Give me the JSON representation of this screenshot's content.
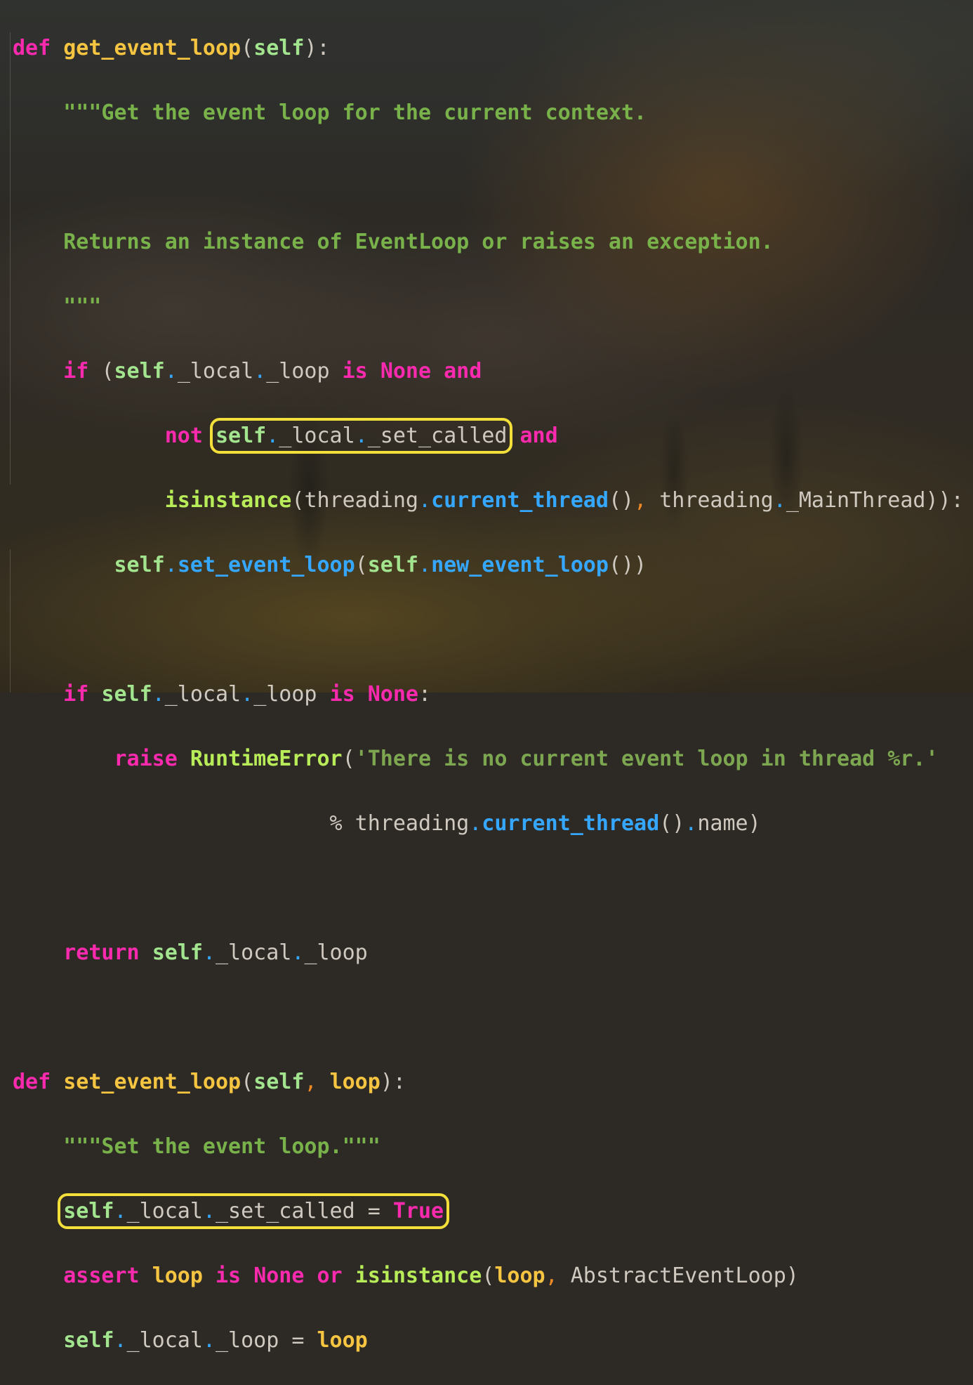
{
  "code": {
    "l1": {
      "def": "def",
      "name": "get_event_loop",
      "open": "(",
      "self": "self",
      "close": "):"
    },
    "l2": {
      "doc": "\"\"\"Get the event loop for the current context."
    },
    "l4": {
      "doc": "Returns an instance of EventLoop or raises an exception."
    },
    "l5": {
      "doc": "\"\"\""
    },
    "l6": {
      "if": "if",
      "open": "(",
      "self": "self",
      "a": "_local",
      "b": "_loop",
      "is": "is",
      "none": "None",
      "and": "and"
    },
    "l7": {
      "not": "not",
      "self": "self",
      "a": "_local",
      "b": "_set_called",
      "and": "and"
    },
    "l8": {
      "isinstance": "isinstance",
      "open": "(",
      "threading": "threading",
      "current_thread": "current_thread",
      "parens": "()",
      "comma": ",",
      "threading2": "threading",
      "main": "_MainThread",
      "close": ")):"
    },
    "l9": {
      "self": "self",
      "set": "set_event_loop",
      "open": "(",
      "self2": "self",
      "new": "new_event_loop",
      "close": "())"
    },
    "l11": {
      "if": "if",
      "self": "self",
      "a": "_local",
      "b": "_loop",
      "is": "is",
      "none": "None",
      "colon": ":"
    },
    "l12": {
      "raise": "raise",
      "err": "RuntimeError",
      "open": "(",
      "str": "'There is no current event loop in thread %r.'"
    },
    "l13": {
      "pct": "%",
      "threading": "threading",
      "current_thread": "current_thread",
      "parens": "()",
      "name": "name",
      "close": ")"
    },
    "l15": {
      "return": "return",
      "self": "self",
      "a": "_local",
      "b": "_loop"
    },
    "l17": {
      "def": "def",
      "name": "set_event_loop",
      "open": "(",
      "self": "self",
      "comma": ",",
      "loop": "loop",
      "close": "):"
    },
    "l18": {
      "doc": "\"\"\"Set the event loop.\"\"\""
    },
    "l19": {
      "self": "self",
      "a": "_local",
      "b": "_set_called",
      "eq": "=",
      "true": "True"
    },
    "l20": {
      "assert": "assert",
      "loop": "loop",
      "is": "is",
      "none": "None",
      "or": "or",
      "isinstance": "isinstance",
      "open": "(",
      "loop2": "loop",
      "comma": ",",
      "cls": "AbstractEventLoop",
      "close": ")"
    },
    "l21": {
      "self": "self",
      "a": "_local",
      "b": "_loop",
      "eq": "=",
      "loop": "loop"
    }
  },
  "colors": {
    "keyword": "#f92aad",
    "function": "#f5c542",
    "self": "#a3e48f",
    "dot_and_call": "#35a7ff",
    "docstring": "#79b24a",
    "highlight_box": "#f3df3a"
  }
}
